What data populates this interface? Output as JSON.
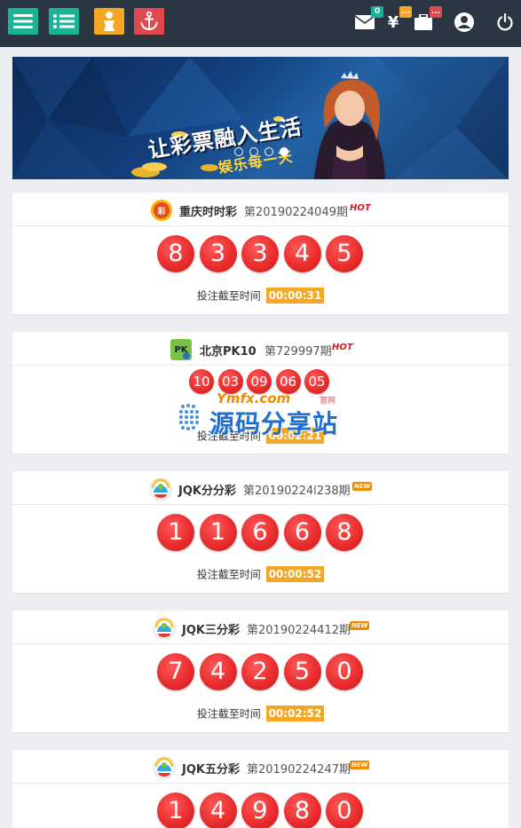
{
  "topbar": {
    "menu_icon": "hamburger-icon",
    "list_icon": "list-icon",
    "person_icon": "person-icon",
    "anchor_icon": "anchor-icon",
    "mail_badge": "0",
    "yen_badge": "...",
    "bag_badge": "...",
    "colors": {
      "bg": "#2b3643",
      "green": "#1ab394",
      "orange": "#f5a623",
      "red": "#e0484e"
    }
  },
  "banner": {
    "slogan_main": "让彩票融入生活",
    "slogan_sub": "娱乐每一天",
    "slide_count": 4,
    "active_slide": 4
  },
  "lotteries": [
    {
      "name": "重庆时时彩",
      "issue": "第20190224049期",
      "tag": "HOT",
      "numbers": [
        "8",
        "3",
        "3",
        "4",
        "5"
      ],
      "deadline_label": "投注截至时间",
      "deadline": "00:00:31"
    },
    {
      "name": "北京PK10",
      "issue": "第729997期",
      "tag": "HOT",
      "numbers": [
        "10",
        "03",
        "09",
        "06",
        "05"
      ],
      "deadline_label": "投注截至时间",
      "deadline": "00:02:21"
    },
    {
      "name": "JQK分分彩",
      "issue": "第20190224l238期",
      "tag": "NEW",
      "numbers": [
        "1",
        "1",
        "6",
        "6",
        "8"
      ],
      "deadline_label": "投注截至时间",
      "deadline": "00:00:52"
    },
    {
      "name": "JQK三分彩",
      "issue": "第20190224412期",
      "tag": "NEW",
      "numbers": [
        "7",
        "4",
        "2",
        "5",
        "0"
      ],
      "deadline_label": "投注截至时间",
      "deadline": "00:02:52"
    },
    {
      "name": "JQK五分彩",
      "issue": "第20190224247期",
      "tag": "NEW",
      "numbers": [
        "1",
        "4",
        "9",
        "8",
        "0"
      ],
      "deadline_label": "",
      "deadline": ""
    }
  ],
  "watermark": {
    "text_top": "Ymfx.com",
    "text_official": "官网",
    "text_main": "源码分享站"
  }
}
